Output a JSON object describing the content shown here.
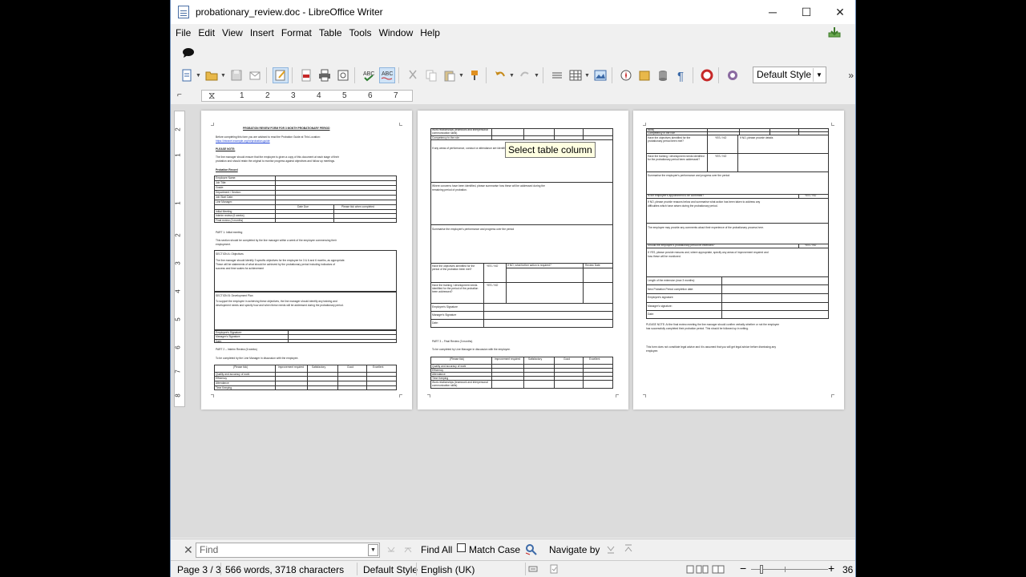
{
  "window": {
    "title": "probationary_review.doc - LibreOffice Writer",
    "controls": {
      "minimize": "─",
      "maximize": "☐",
      "close": "✕"
    }
  },
  "menu": [
    "File",
    "Edit",
    "View",
    "Insert",
    "Format",
    "Table",
    "Tools",
    "Window",
    "Help"
  ],
  "toolbar": {
    "paragraph_style": "Default Style"
  },
  "ruler": {
    "numbers": [
      "1",
      "2",
      "3",
      "4",
      "5",
      "6",
      "7"
    ]
  },
  "vruler": {
    "numbers": [
      "2",
      "1",
      "1",
      "2",
      "3",
      "4",
      "5",
      "6",
      "7",
      "8"
    ]
  },
  "tooltip": "Select table column",
  "page1": {
    "heading": "PROBATION REVIEW FORM FOR 3 MONTH PROBATIONARY PERIOD",
    "intro": "Before completing this form you are advised to read the Probation Guide at This Location:",
    "link": "https://intranet.example.org/hr/probation-guide",
    "please_note": "PLEASE NOTE:",
    "note_text_1": "The line manager should ensure that the employee is given a copy of this document at each stage of their",
    "note_text_2": "probation and should retain the original to monitor progress against objectives and follow up meetings.",
    "probation_record": "Probation Record",
    "record_rows": [
      "Employee Name:",
      "Job Title:",
      "Grade:",
      "Department / Section:",
      "Job Start Date:",
      "Line Manager:"
    ],
    "review_header": [
      "",
      "Date Due",
      "Please tick when completed"
    ],
    "review_rows": [
      "Initial Meeting",
      "Interim review (6 weeks)",
      "Final review (3 months)"
    ],
    "part1": "PART 1: Initial meeting",
    "part1_text_1": "This section should be completed by the line manager within a week of the employee commencing their",
    "part1_text_2": "employment.",
    "sectionA_title": "SECTION A: Objectives",
    "sectionA_text_1": "The line manager should identify 3 specific objectives for the employee for 3 & 6 and 6 months, as appropriate.",
    "sectionA_text_2": "These will be statements of what should be achieved by the probationary period including indicators of",
    "sectionA_text_3": "success and time scales for achievement",
    "sectionB_title": "SECTION B: Development Plan",
    "sectionB_text_1": "To support the employee in achieving these objectives, the line manager should identify any training and",
    "sectionB_text_2": "development needs and specify how and when these needs will be addressed during the probationary period.",
    "signatures": [
      "Employee's Signature:",
      "Manager's Signature:",
      "Date:"
    ],
    "part2": "PART 2 – Interim Review (6 weeks)",
    "part2_text": "To be completed by the Line Manager in discussion with the employee.",
    "rating_header": [
      "(Please tick)",
      "Improvement required",
      "Satisfactory",
      "Good",
      "Excellent"
    ],
    "rating_rows": [
      "Quality and accuracy of work",
      "Efficiency",
      "Attendance",
      "Time Keeping"
    ]
  },
  "page2": {
    "top_rows": [
      "Work relationships (teamwork and interpersonal communication skills)",
      "Competency in the role"
    ],
    "concerns_1": "If any areas of performance, conduct or attendance are identified please provide details below.",
    "concerns_2": "Where concerns have been identified, please summarise how these will be addressed during the",
    "concerns_3": "remaining period of probation.",
    "summarise": "Summarise the employee's performance and progress over the period",
    "objectives_q": "Have the objectives identified for the period of the probation been met?",
    "yes_no": "YES / NO",
    "further_action": "If NO, what further action is required?",
    "review_date": "Review Date",
    "training_q": "Have the training / development needs identified for the period of the probation been addressed?",
    "signatures": [
      "Employee's Signature",
      "Manager's Signature",
      "Date:"
    ],
    "part3": "PART 3 – Final Review (3 months)",
    "part3_text": "To be completed by Line Manager in discussion with the employee.",
    "rating_header": [
      "(Please tick)",
      "Improvement required",
      "Satisfactory",
      "Good",
      "Excellent"
    ],
    "rating_rows": [
      "Quality and accuracy of work",
      "Efficiency",
      "Attendance",
      "Time Keeping",
      "Work relationships (teamwork and interpersonal communication skills)"
    ]
  },
  "page3": {
    "top_rows": [
      "skills)",
      "Competency in the role"
    ],
    "objectives_q": "Have the objectives identified for the probationary period been met?",
    "yes_no": "YES / NO",
    "if_no": "If NO, please provide details",
    "training_q": "Have the training / development needs identified for the probationary period been addressed?",
    "summarise": "Summarise the employee's performance and progress over the period",
    "confirmed_q": "Is the employee's appointment to be confirmed?",
    "if_no_text_1": "If NO, please provide reasons below and summarise what action has been taken to address any",
    "if_no_text_2": "difficulties which have arisen during the probationary period.",
    "comments": "The employee may provide any comments about their experience of the probationary process here.",
    "extended_q": "Should the employee's probationary period be extended?",
    "if_yes_text_1": "If YES, please provide reasons and, where appropriate, specify any areas of improvement required and",
    "if_yes_text_2": "how these will be monitored.",
    "extension_rows": [
      "Length of the extension (max 3 months):",
      "New Probation Period completion date:",
      "Employee's signature:",
      "Manager's signature:",
      "Date:"
    ],
    "note_1": "PLEASE NOTE: At the final review meeting the line manager should confirm verbally whether or not the employee",
    "note_2": "has successfully completed their probation period. This should be followed up in writing.",
    "legal_1": "This form does not constitute legal advice and it is assumed that you will get legal advice before dismissing any",
    "legal_2": "employee."
  },
  "findbar": {
    "close": "✕",
    "placeholder": "Find",
    "find_all": "Find All",
    "match_case": "Match Case",
    "navigate_by": "Navigate by"
  },
  "statusbar": {
    "page": "Page 3 / 3",
    "words": "566 words, 3718 characters",
    "style": "Default Style",
    "language": "English (UK)",
    "zoom": "36"
  }
}
